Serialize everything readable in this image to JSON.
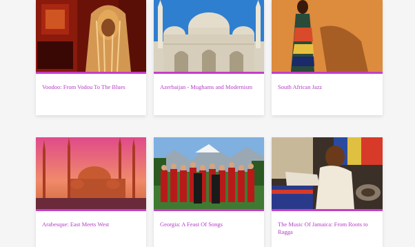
{
  "row1": [
    {
      "title": "Voodoo: From Vodou To The Blues",
      "image_icon": "voodoo-photo-icon"
    },
    {
      "title": "Azerbaijan - Mughams and Modernism",
      "image_icon": "mosque-photo-icon"
    },
    {
      "title": "South African Jazz",
      "image_icon": "african-woman-photo-icon"
    }
  ],
  "row2": [
    {
      "title": "Arabesque: East Meets West",
      "image_icon": "blue-mosque-photo-icon"
    },
    {
      "title": "Georgia: A Feast Of Songs",
      "image_icon": "georgian-choir-photo-icon"
    },
    {
      "title": "The Music Of Jamaica: From Roots to Ragga",
      "image_icon": "jamaican-musician-photo-icon"
    }
  ],
  "colors": {
    "accent": "#c23fc7",
    "caption": "#b33cc4",
    "background": "#f5f5f6"
  }
}
